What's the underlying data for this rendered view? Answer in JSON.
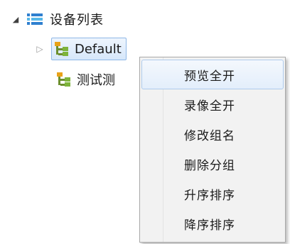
{
  "tree": {
    "root": {
      "label": "设备列表",
      "expander": "expanded",
      "icon": "device-list-icon"
    },
    "groups": [
      {
        "label": "Default",
        "expander": "collapsed",
        "icon": "group-tree-icon",
        "selected": true
      },
      {
        "label": "测试测",
        "icon": "group-tree-icon",
        "selected": false
      }
    ]
  },
  "context_menu": {
    "items": [
      {
        "label": "预览全开",
        "highlighted": true
      },
      {
        "label": "录像全开",
        "highlighted": false
      },
      {
        "label": "修改组名",
        "highlighted": false
      },
      {
        "label": "删除分组",
        "highlighted": false
      },
      {
        "label": "升序排序",
        "highlighted": false
      },
      {
        "label": "降序排序",
        "highlighted": false
      }
    ]
  },
  "colors": {
    "selection_border": "#8fb7e6",
    "selection_fill": "#d6e7fa",
    "menu_background": "#f2f2f2",
    "menu_border": "#a9a9a9",
    "list_icon_blue": "#2f80cf",
    "group_icon_orange": "#e8a21a",
    "group_icon_green": "#7db33a"
  }
}
